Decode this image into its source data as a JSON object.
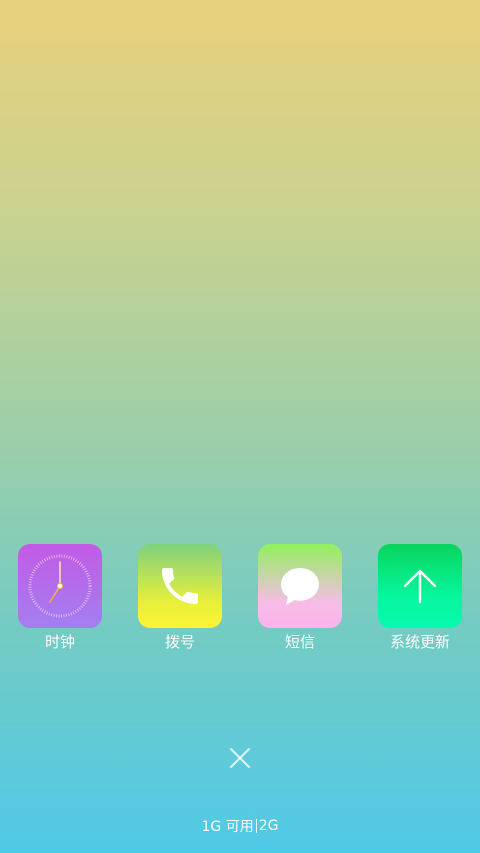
{
  "apps": [
    {
      "label": "时钟",
      "icon": "clock-icon"
    },
    {
      "label": "拨号",
      "icon": "phone-icon"
    },
    {
      "label": "短信",
      "icon": "message-bubble-icon"
    },
    {
      "label": "系统更新",
      "icon": "arrow-up-icon"
    }
  ],
  "clock": {
    "hour": 7,
    "minute": 0
  },
  "close": {
    "icon": "close-icon"
  },
  "memory": {
    "available": "1G 可用",
    "total": "2G"
  },
  "colors": {
    "background_top": "#e9d07c",
    "background_bottom": "#4fc9e8",
    "clock_icon": "#c35ae6",
    "dialer_icon": "#e9ef3a",
    "sms_icon": "#92f05c",
    "update_icon": "#07f59c",
    "clock_hour_hand": "#f0b04a"
  }
}
